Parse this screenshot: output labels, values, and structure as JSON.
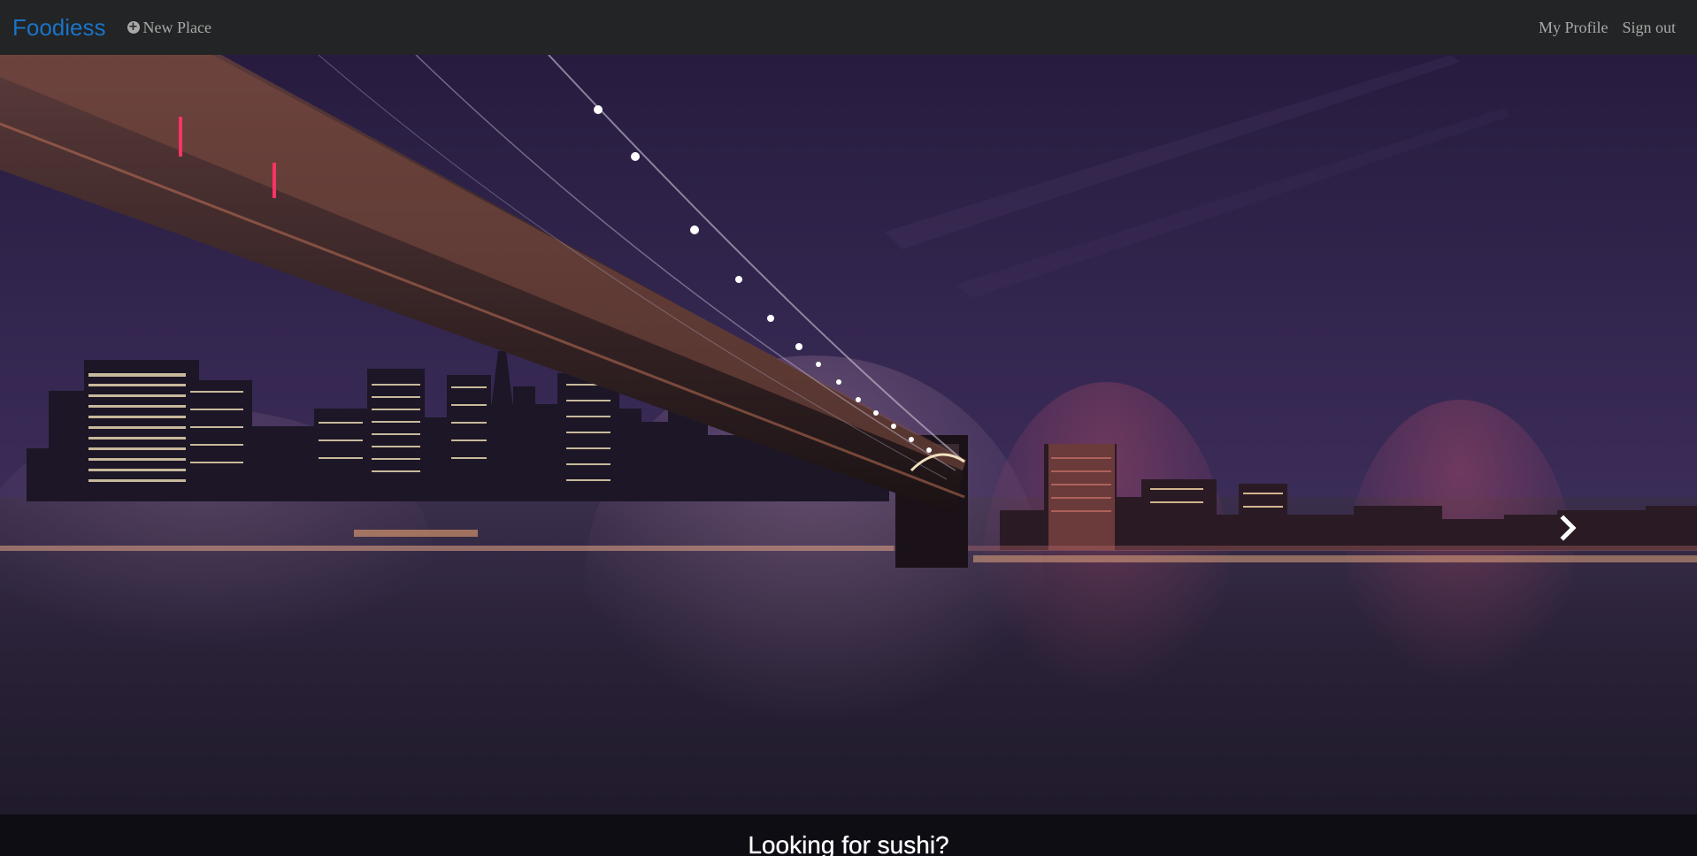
{
  "navbar": {
    "brand": "Foodiess",
    "new_place_label": "New Place",
    "new_place_icon": "plus-circle-icon",
    "my_profile_label": "My Profile",
    "sign_out_label": "Sign out"
  },
  "carousel": {
    "next_icon": "chevron-right-icon",
    "caption": "Looking for sushi?"
  },
  "colors": {
    "navbar_bg": "#232425",
    "brand": "#1a73c8",
    "nav_link": "#a9a9a9",
    "sky": "#2c2144",
    "water": "#231c35"
  }
}
